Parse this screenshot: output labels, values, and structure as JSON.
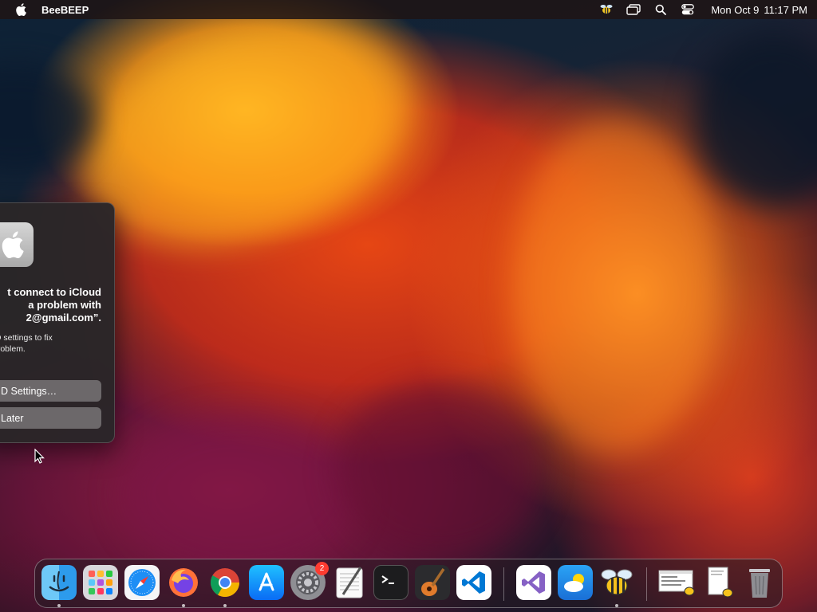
{
  "menubar": {
    "app_name": "BeeBEEP",
    "date": "Mon Oct 9",
    "time": "11:17 PM"
  },
  "dialog": {
    "title": "t connect to iCloud\na problem with\n2@gmail.com”.",
    "body": "ID settings to fix\nproblem.",
    "primary_button": "D Settings…",
    "secondary_button": "Later"
  },
  "dock": {
    "items": [
      "finder-icon",
      "launchpad-icon",
      "safari-icon",
      "firefox-icon",
      "chrome-icon",
      "app-store-icon",
      "system-settings-icon",
      "textedit-icon",
      "terminal-icon",
      "garageband-icon",
      "vscode-icon",
      "visual-studio-icon",
      "weather-icon",
      "beebeep-icon",
      "window-thumbnail-icon",
      "document-thumbnail-icon",
      "trash-icon"
    ],
    "settings_badge": "2"
  },
  "colors": {
    "accent_red": "#ff3b30",
    "menubar_bg": "#1e1414",
    "dialog_bg": "#2a2628"
  }
}
